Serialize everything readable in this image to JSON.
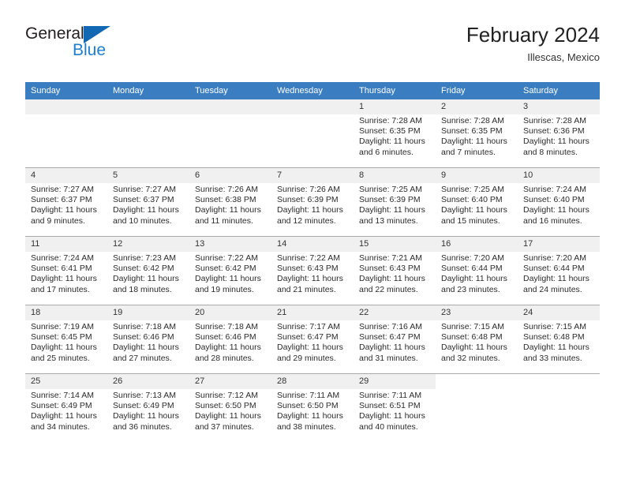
{
  "brand": {
    "name_top": "General",
    "name_bottom": "Blue",
    "flag_color": "#1268b3",
    "blue_color": "#1b7ed0"
  },
  "header": {
    "title": "February 2024",
    "location": "Illescas, Mexico"
  },
  "colors": {
    "header_blue": "#3a7ec1",
    "daynum_bg": "#f0f0f0",
    "grid_line": "#a9a9a9"
  },
  "weekday_headers": [
    "Sunday",
    "Monday",
    "Tuesday",
    "Wednesday",
    "Thursday",
    "Friday",
    "Saturday"
  ],
  "weeks": [
    [
      {
        "day": "",
        "sunrise": "",
        "sunset": "",
        "daylight1": "",
        "daylight2": "",
        "state": "empty"
      },
      {
        "day": "",
        "sunrise": "",
        "sunset": "",
        "daylight1": "",
        "daylight2": "",
        "state": "empty"
      },
      {
        "day": "",
        "sunrise": "",
        "sunset": "",
        "daylight1": "",
        "daylight2": "",
        "state": "empty"
      },
      {
        "day": "",
        "sunrise": "",
        "sunset": "",
        "daylight1": "",
        "daylight2": "",
        "state": "empty"
      },
      {
        "day": "1",
        "sunrise": "Sunrise: 7:28 AM",
        "sunset": "Sunset: 6:35 PM",
        "daylight1": "Daylight: 11 hours",
        "daylight2": "and 6 minutes.",
        "state": "filled"
      },
      {
        "day": "2",
        "sunrise": "Sunrise: 7:28 AM",
        "sunset": "Sunset: 6:35 PM",
        "daylight1": "Daylight: 11 hours",
        "daylight2": "and 7 minutes.",
        "state": "filled"
      },
      {
        "day": "3",
        "sunrise": "Sunrise: 7:28 AM",
        "sunset": "Sunset: 6:36 PM",
        "daylight1": "Daylight: 11 hours",
        "daylight2": "and 8 minutes.",
        "state": "filled"
      }
    ],
    [
      {
        "day": "4",
        "sunrise": "Sunrise: 7:27 AM",
        "sunset": "Sunset: 6:37 PM",
        "daylight1": "Daylight: 11 hours",
        "daylight2": "and 9 minutes.",
        "state": "filled"
      },
      {
        "day": "5",
        "sunrise": "Sunrise: 7:27 AM",
        "sunset": "Sunset: 6:37 PM",
        "daylight1": "Daylight: 11 hours",
        "daylight2": "and 10 minutes.",
        "state": "filled"
      },
      {
        "day": "6",
        "sunrise": "Sunrise: 7:26 AM",
        "sunset": "Sunset: 6:38 PM",
        "daylight1": "Daylight: 11 hours",
        "daylight2": "and 11 minutes.",
        "state": "filled"
      },
      {
        "day": "7",
        "sunrise": "Sunrise: 7:26 AM",
        "sunset": "Sunset: 6:39 PM",
        "daylight1": "Daylight: 11 hours",
        "daylight2": "and 12 minutes.",
        "state": "filled"
      },
      {
        "day": "8",
        "sunrise": "Sunrise: 7:25 AM",
        "sunset": "Sunset: 6:39 PM",
        "daylight1": "Daylight: 11 hours",
        "daylight2": "and 13 minutes.",
        "state": "filled"
      },
      {
        "day": "9",
        "sunrise": "Sunrise: 7:25 AM",
        "sunset": "Sunset: 6:40 PM",
        "daylight1": "Daylight: 11 hours",
        "daylight2": "and 15 minutes.",
        "state": "filled"
      },
      {
        "day": "10",
        "sunrise": "Sunrise: 7:24 AM",
        "sunset": "Sunset: 6:40 PM",
        "daylight1": "Daylight: 11 hours",
        "daylight2": "and 16 minutes.",
        "state": "filled"
      }
    ],
    [
      {
        "day": "11",
        "sunrise": "Sunrise: 7:24 AM",
        "sunset": "Sunset: 6:41 PM",
        "daylight1": "Daylight: 11 hours",
        "daylight2": "and 17 minutes.",
        "state": "filled"
      },
      {
        "day": "12",
        "sunrise": "Sunrise: 7:23 AM",
        "sunset": "Sunset: 6:42 PM",
        "daylight1": "Daylight: 11 hours",
        "daylight2": "and 18 minutes.",
        "state": "filled"
      },
      {
        "day": "13",
        "sunrise": "Sunrise: 7:22 AM",
        "sunset": "Sunset: 6:42 PM",
        "daylight1": "Daylight: 11 hours",
        "daylight2": "and 19 minutes.",
        "state": "filled"
      },
      {
        "day": "14",
        "sunrise": "Sunrise: 7:22 AM",
        "sunset": "Sunset: 6:43 PM",
        "daylight1": "Daylight: 11 hours",
        "daylight2": "and 21 minutes.",
        "state": "filled"
      },
      {
        "day": "15",
        "sunrise": "Sunrise: 7:21 AM",
        "sunset": "Sunset: 6:43 PM",
        "daylight1": "Daylight: 11 hours",
        "daylight2": "and 22 minutes.",
        "state": "filled"
      },
      {
        "day": "16",
        "sunrise": "Sunrise: 7:20 AM",
        "sunset": "Sunset: 6:44 PM",
        "daylight1": "Daylight: 11 hours",
        "daylight2": "and 23 minutes.",
        "state": "filled"
      },
      {
        "day": "17",
        "sunrise": "Sunrise: 7:20 AM",
        "sunset": "Sunset: 6:44 PM",
        "daylight1": "Daylight: 11 hours",
        "daylight2": "and 24 minutes.",
        "state": "filled"
      }
    ],
    [
      {
        "day": "18",
        "sunrise": "Sunrise: 7:19 AM",
        "sunset": "Sunset: 6:45 PM",
        "daylight1": "Daylight: 11 hours",
        "daylight2": "and 25 minutes.",
        "state": "filled"
      },
      {
        "day": "19",
        "sunrise": "Sunrise: 7:18 AM",
        "sunset": "Sunset: 6:46 PM",
        "daylight1": "Daylight: 11 hours",
        "daylight2": "and 27 minutes.",
        "state": "filled"
      },
      {
        "day": "20",
        "sunrise": "Sunrise: 7:18 AM",
        "sunset": "Sunset: 6:46 PM",
        "daylight1": "Daylight: 11 hours",
        "daylight2": "and 28 minutes.",
        "state": "filled"
      },
      {
        "day": "21",
        "sunrise": "Sunrise: 7:17 AM",
        "sunset": "Sunset: 6:47 PM",
        "daylight1": "Daylight: 11 hours",
        "daylight2": "and 29 minutes.",
        "state": "filled"
      },
      {
        "day": "22",
        "sunrise": "Sunrise: 7:16 AM",
        "sunset": "Sunset: 6:47 PM",
        "daylight1": "Daylight: 11 hours",
        "daylight2": "and 31 minutes.",
        "state": "filled"
      },
      {
        "day": "23",
        "sunrise": "Sunrise: 7:15 AM",
        "sunset": "Sunset: 6:48 PM",
        "daylight1": "Daylight: 11 hours",
        "daylight2": "and 32 minutes.",
        "state": "filled"
      },
      {
        "day": "24",
        "sunrise": "Sunrise: 7:15 AM",
        "sunset": "Sunset: 6:48 PM",
        "daylight1": "Daylight: 11 hours",
        "daylight2": "and 33 minutes.",
        "state": "filled"
      }
    ],
    [
      {
        "day": "25",
        "sunrise": "Sunrise: 7:14 AM",
        "sunset": "Sunset: 6:49 PM",
        "daylight1": "Daylight: 11 hours",
        "daylight2": "and 34 minutes.",
        "state": "filled"
      },
      {
        "day": "26",
        "sunrise": "Sunrise: 7:13 AM",
        "sunset": "Sunset: 6:49 PM",
        "daylight1": "Daylight: 11 hours",
        "daylight2": "and 36 minutes.",
        "state": "filled"
      },
      {
        "day": "27",
        "sunrise": "Sunrise: 7:12 AM",
        "sunset": "Sunset: 6:50 PM",
        "daylight1": "Daylight: 11 hours",
        "daylight2": "and 37 minutes.",
        "state": "filled"
      },
      {
        "day": "28",
        "sunrise": "Sunrise: 7:11 AM",
        "sunset": "Sunset: 6:50 PM",
        "daylight1": "Daylight: 11 hours",
        "daylight2": "and 38 minutes.",
        "state": "filled"
      },
      {
        "day": "29",
        "sunrise": "Sunrise: 7:11 AM",
        "sunset": "Sunset: 6:51 PM",
        "daylight1": "Daylight: 11 hours",
        "daylight2": "and 40 minutes.",
        "state": "filled"
      },
      {
        "day": "",
        "sunrise": "",
        "sunset": "",
        "daylight1": "",
        "daylight2": "",
        "state": "blank"
      },
      {
        "day": "",
        "sunrise": "",
        "sunset": "",
        "daylight1": "",
        "daylight2": "",
        "state": "blank"
      }
    ]
  ]
}
